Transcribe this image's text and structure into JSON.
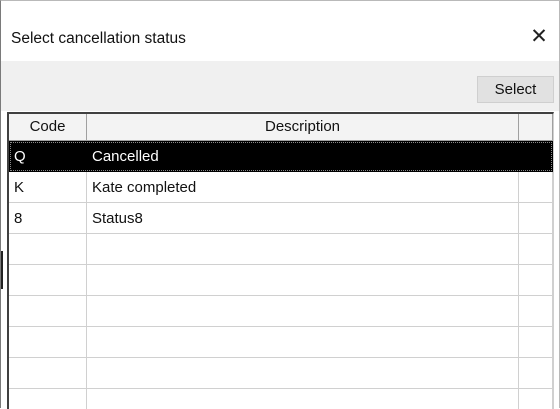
{
  "dialog": {
    "title": "Select cancellation status",
    "close_glyph": "✕"
  },
  "toolbar": {
    "select_label": "Select"
  },
  "table": {
    "columns": [
      "Code",
      "Description",
      ""
    ],
    "rows": [
      {
        "code": "Q",
        "description": "Cancelled",
        "selected": true
      },
      {
        "code": "K",
        "description": "Kate completed",
        "selected": false
      },
      {
        "code": "8",
        "description": "Status8",
        "selected": false
      },
      {
        "code": "",
        "description": "",
        "selected": false
      },
      {
        "code": "",
        "description": "",
        "selected": false
      },
      {
        "code": "",
        "description": "",
        "selected": false
      },
      {
        "code": "",
        "description": "",
        "selected": false
      },
      {
        "code": "",
        "description": "",
        "selected": false
      },
      {
        "code": "",
        "description": "",
        "selected": false
      }
    ]
  },
  "colors": {
    "selected_row_bg": "#000000",
    "toolbar_bg": "#f0f0f0"
  },
  "icons": {
    "close": "close-icon"
  }
}
